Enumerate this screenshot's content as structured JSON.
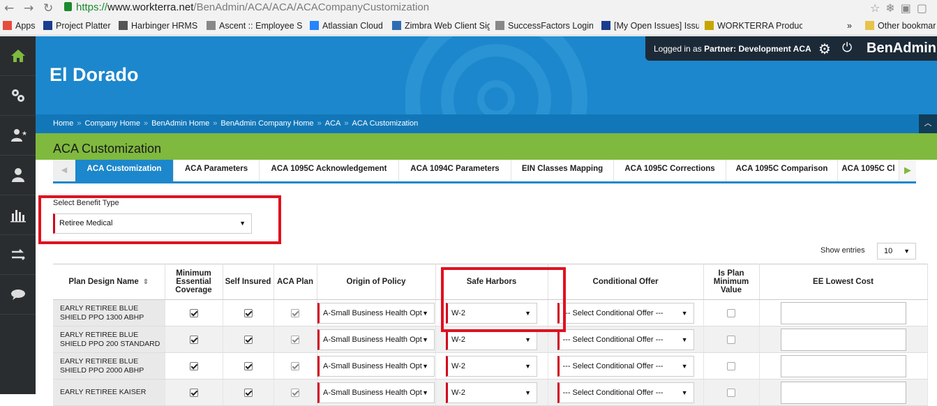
{
  "browser": {
    "url_secure": "https://",
    "url_domain": "www.workterra.net",
    "url_path": "/BenAdmin/ACA/ACA/ACACompanyCustomization"
  },
  "bookmarks": [
    {
      "label": "Apps",
      "color": "#e74c3c"
    },
    {
      "label": "Project Platter",
      "color": "#1a3d8f"
    },
    {
      "label": "Harbinger HRMS",
      "color": "#555555"
    },
    {
      "label": "Ascent :: Employee Se",
      "color": "#888888"
    },
    {
      "label": "Atlassian Cloud",
      "color": "#2684ff"
    },
    {
      "label": "Zimbra Web Client Sig",
      "color": "#2f6db3"
    },
    {
      "label": "SuccessFactors Login",
      "color": "#888888"
    },
    {
      "label": "[My Open Issues] Issu",
      "color": "#1a3d8f"
    },
    {
      "label": "WORKTERRA Product",
      "color": "#c7a500"
    }
  ],
  "bookmarks_more": "»",
  "bookmarks_other": "Other bookmar",
  "header": {
    "company": "El Dorado",
    "login_prefix": "Logged in as",
    "login_role": "Partner:",
    "login_name": "Development ACA",
    "app_name": "BenAdmin"
  },
  "breadcrumb": [
    "Home",
    "Company Home",
    "BenAdmin Home",
    "BenAdmin Company Home",
    "ACA",
    "ACA Customization"
  ],
  "page_title": "ACA Customization",
  "tabs": [
    "ACA Customization",
    "ACA Parameters",
    "ACA 1095C Acknowledgement",
    "ACA 1094C Parameters",
    "EIN Classes Mapping",
    "ACA 1095C Corrections",
    "ACA 1095C Comparison",
    "ACA 1095C Cl"
  ],
  "benefit": {
    "label": "Select Benefit Type",
    "value": "Retiree Medical"
  },
  "show_entries": {
    "label": "Show entries",
    "value": "10"
  },
  "table": {
    "headers": {
      "plan": "Plan Design Name",
      "mec": "Minimum Essential Coverage",
      "self": "Self Insured",
      "aca": "ACA Plan",
      "origin": "Origin of Policy",
      "safe": "Safe Harbors",
      "cond": "Conditional Offer",
      "minval": "Is Plan Minimum Value",
      "lowest": "EE Lowest Cost"
    },
    "rows": [
      {
        "name": "EARLY RETIREE BLUE SHIELD PPO 1300 ABHP",
        "mec": true,
        "self": true,
        "aca": true,
        "origin": "A-Small Business Health Opt",
        "safe": "W-2",
        "cond": "--- Select Conditional Offer ---",
        "minval": false,
        "lowest": ""
      },
      {
        "name": "EARLY RETIREE BLUE SHIELD PPO 200 STANDARD",
        "mec": true,
        "self": true,
        "aca": true,
        "origin": "A-Small Business Health Opt",
        "safe": "W-2",
        "cond": "--- Select Conditional Offer ---",
        "minval": false,
        "lowest": ""
      },
      {
        "name": "EARLY RETIREE BLUE SHIELD PPO 2000 ABHP",
        "mec": true,
        "self": true,
        "aca": true,
        "origin": "A-Small Business Health Opt",
        "safe": "W-2",
        "cond": "--- Select Conditional Offer ---",
        "minval": false,
        "lowest": ""
      },
      {
        "name": "EARLY RETIREE KAISER",
        "mec": true,
        "self": true,
        "aca": true,
        "origin": "A-Small Business Health Opt",
        "safe": "W-2",
        "cond": "--- Select Conditional Offer ---",
        "minval": false,
        "lowest": ""
      }
    ]
  }
}
